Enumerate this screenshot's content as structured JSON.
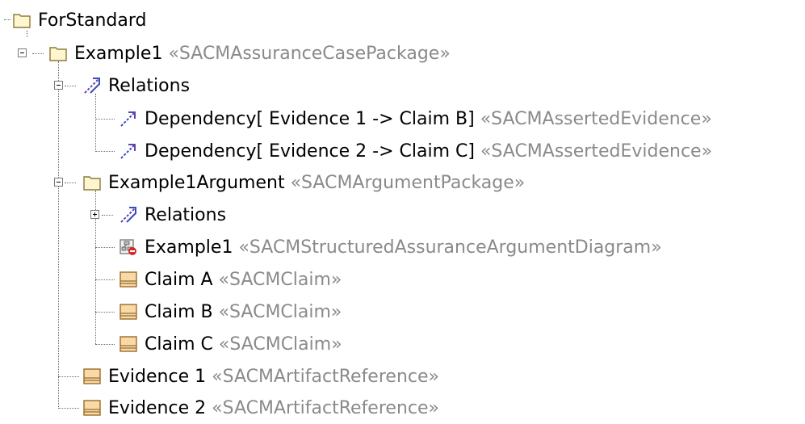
{
  "tree": {
    "root": {
      "label": "ForStandard",
      "icon": "folder-icon"
    },
    "package": {
      "label": "Example1",
      "stereotype": "«SACMAssuranceCasePackage»",
      "icon": "folder-icon"
    },
    "relations1": {
      "label": "Relations",
      "icon": "relations-icon"
    },
    "dep1": {
      "label": "Dependency[ Evidence 1 ->  Claim B]",
      "stereotype": "«SACMAssertedEvidence»",
      "icon": "dependency-icon"
    },
    "dep2": {
      "label": "Dependency[ Evidence 2 ->  Claim C]",
      "stereotype": "«SACMAssertedEvidence»",
      "icon": "dependency-icon"
    },
    "argpkg": {
      "label": "Example1Argument",
      "stereotype": "«SACMArgumentPackage»",
      "icon": "folder-icon"
    },
    "relations2": {
      "label": "Relations",
      "icon": "relations-icon"
    },
    "diagram": {
      "label": "Example1",
      "stereotype": "«SACMStructuredAssuranceArgumentDiagram»",
      "icon": "diagram-icon"
    },
    "claimA": {
      "label": "Claim A",
      "stereotype": "«SACMClaim»",
      "icon": "element-icon"
    },
    "claimB": {
      "label": "Claim B",
      "stereotype": "«SACMClaim»",
      "icon": "element-icon"
    },
    "claimC": {
      "label": "Claim C",
      "stereotype": "«SACMClaim»",
      "icon": "element-icon"
    },
    "ev1": {
      "label": "Evidence 1",
      "stereotype": "«SACMArtifactReference»",
      "icon": "element-icon"
    },
    "ev2": {
      "label": "Evidence 2",
      "stereotype": "«SACMArtifactReference»",
      "icon": "element-icon"
    }
  },
  "colors": {
    "folder_fill": "#fff6cf",
    "folder_stroke": "#8a7a3a",
    "relation_blue": "#3b4cc0",
    "relation_purple": "#6a3fb0",
    "element_fill": "#f8d9a8",
    "element_stroke": "#9b6b2a",
    "stereotype_text": "#8a8a8a"
  }
}
